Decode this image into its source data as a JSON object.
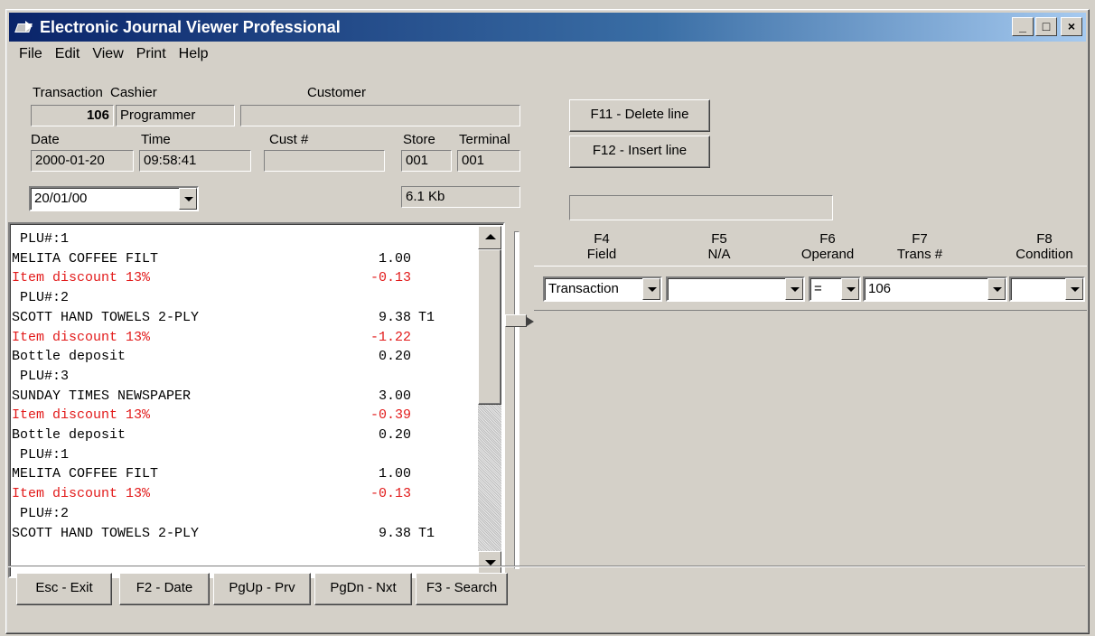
{
  "window": {
    "title": "Electronic Journal Viewer Professional",
    "controls": {
      "minimize": "_",
      "maximize": "□",
      "close": "×"
    }
  },
  "menu": [
    {
      "label": "File"
    },
    {
      "label": "Edit"
    },
    {
      "label": "View"
    },
    {
      "label": "Print"
    },
    {
      "label": "Help"
    }
  ],
  "header": {
    "transaction_label": "Transaction",
    "cashier_label": "Cashier",
    "customer_label": "Customer",
    "transaction_value": "106",
    "cashier_value": "Programmer",
    "customer_value": "",
    "date_label": "Date",
    "time_label": "Time",
    "cust_no_label": "Cust #",
    "store_label": "Store",
    "terminal_label": "Terminal",
    "date_value": "2000-01-20",
    "time_value": "09:58:41",
    "cust_no_value": "",
    "store_value": "001",
    "terminal_value": "001",
    "date_select_value": "20/01/00",
    "size_value": "6.1 Kb"
  },
  "actions": {
    "delete_line": "F11 - Delete line",
    "insert_line": "F12 - Insert line"
  },
  "progress_value": "",
  "journal_lines": [
    {
      "text": " PLU#:1",
      "amount": "",
      "tax": "",
      "red": false
    },
    {
      "text": "MELITA COFFEE FILT",
      "amount": "1.00",
      "tax": "",
      "red": false
    },
    {
      "text": "Item discount 13%",
      "amount": "-0.13",
      "tax": "",
      "red": true
    },
    {
      "text": " PLU#:2",
      "amount": "",
      "tax": "",
      "red": false
    },
    {
      "text": "SCOTT HAND TOWELS 2-PLY",
      "amount": "9.38",
      "tax": "T1",
      "red": false
    },
    {
      "text": "Item discount 13%",
      "amount": "-1.22",
      "tax": "",
      "red": true
    },
    {
      "text": "Bottle deposit",
      "amount": "0.20",
      "tax": "",
      "red": false
    },
    {
      "text": " PLU#:3",
      "amount": "",
      "tax": "",
      "red": false
    },
    {
      "text": "SUNDAY TIMES NEWSPAPER",
      "amount": "3.00",
      "tax": "",
      "red": false
    },
    {
      "text": "Item discount 13%",
      "amount": "-0.39",
      "tax": "",
      "red": true
    },
    {
      "text": "Bottle deposit",
      "amount": "0.20",
      "tax": "",
      "red": false
    },
    {
      "text": " PLU#:1",
      "amount": "",
      "tax": "",
      "red": false
    },
    {
      "text": "MELITA COFFEE FILT",
      "amount": "1.00",
      "tax": "",
      "red": false
    },
    {
      "text": "Item discount 13%",
      "amount": "-0.13",
      "tax": "",
      "red": true
    },
    {
      "text": " PLU#:2",
      "amount": "",
      "tax": "",
      "red": false
    },
    {
      "text": "SCOTT HAND TOWELS 2-PLY",
      "amount": "9.38",
      "tax": "T1",
      "red": false
    }
  ],
  "filter": {
    "columns": [
      {
        "key": "F4",
        "label": "Field",
        "value": "Transaction"
      },
      {
        "key": "F5",
        "label": "N/A",
        "value": ""
      },
      {
        "key": "F6",
        "label": "Operand",
        "value": "="
      },
      {
        "key": "F7",
        "label": "Trans #",
        "value": "106"
      },
      {
        "key": "F8",
        "label": "Condition",
        "value": ""
      }
    ]
  },
  "footer_buttons": [
    {
      "label": "Esc - Exit"
    },
    {
      "label": "F2 - Date"
    },
    {
      "label": "PgUp - Prv"
    },
    {
      "label": "PgDn - Nxt"
    },
    {
      "label": "F3 - Search"
    }
  ],
  "colors": {
    "title_start": "#0a246a",
    "title_end": "#a6caf0",
    "discount_red": "#e21b1b",
    "face": "#d4d0c8"
  }
}
